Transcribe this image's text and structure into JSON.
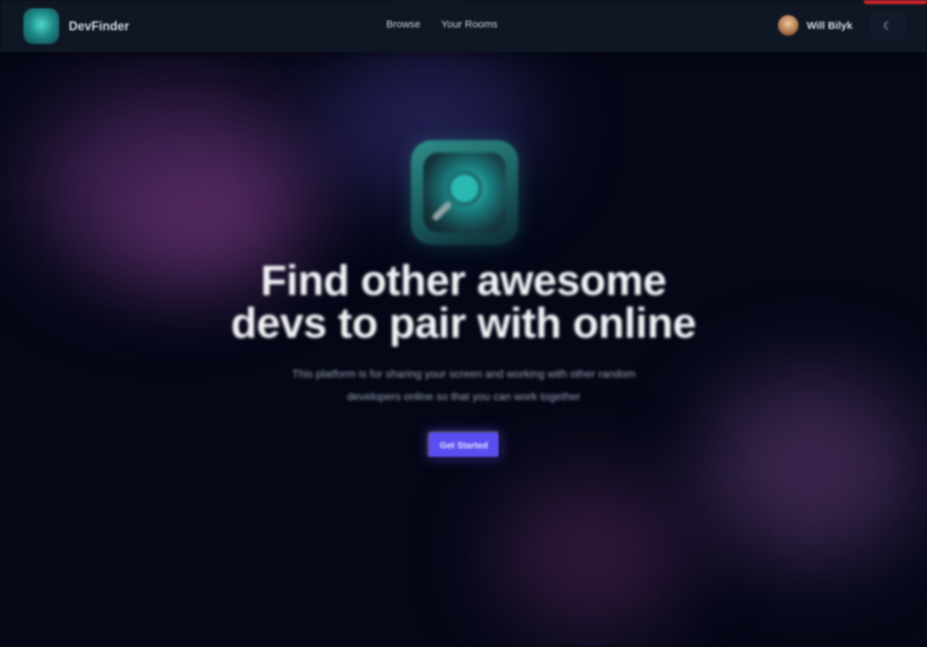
{
  "header": {
    "brand_name": "DevFinder",
    "nav": [
      {
        "label": "Browse"
      },
      {
        "label": "Your Rooms"
      }
    ],
    "user": {
      "name": "Will Bilyk"
    },
    "theme_toggle_icon": "☾"
  },
  "hero": {
    "headline_line1": "Find other awesome",
    "headline_line2": "devs to pair with online",
    "subtitle_line1": "This platform is for sharing your screen and working with other random",
    "subtitle_line2": "developers online so that you can work together",
    "cta_label": "Get Started"
  },
  "colors": {
    "background": "#050816",
    "header_bg": "#0f1724",
    "accent_button": "#5a4ef0",
    "brand_teal": "#2ab9b1",
    "top_accent": "#c8232c"
  },
  "icons": {
    "brand": "magnifier-logo-icon",
    "theme": "moon-icon"
  }
}
